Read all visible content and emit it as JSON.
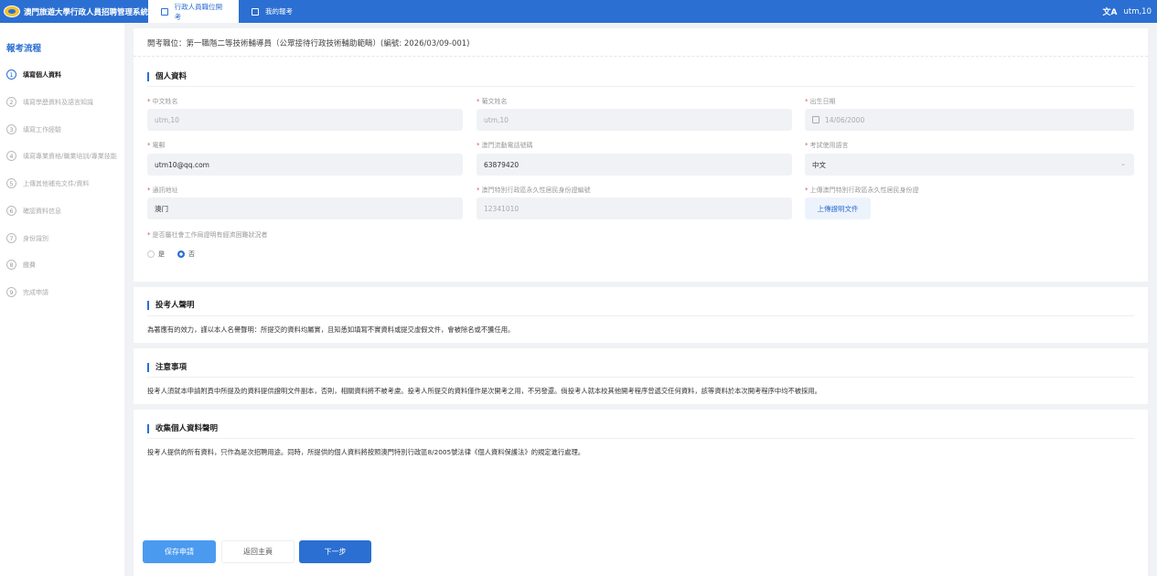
{
  "header": {
    "app_title": "澳門旅遊大學行政人員招聘管理系統",
    "tabs": [
      {
        "label": "行政人員職位開考"
      },
      {
        "label": "我的報考"
      }
    ],
    "user": "utm,10",
    "translate_glyph": "文A"
  },
  "sidebar": {
    "title": "報考流程",
    "steps": [
      {
        "num": "1",
        "label": "填寫個人資料"
      },
      {
        "num": "2",
        "label": "填寫學歷資料及語言知識"
      },
      {
        "num": "3",
        "label": "填寫工作經驗"
      },
      {
        "num": "4",
        "label": "填寫專業資格/職業培訓/專業技能"
      },
      {
        "num": "5",
        "label": "上傳其他補充文件/資料"
      },
      {
        "num": "6",
        "label": "確認資料信息"
      },
      {
        "num": "7",
        "label": "身份識別"
      },
      {
        "num": "8",
        "label": "繳費"
      },
      {
        "num": "9",
        "label": "完成申請"
      }
    ]
  },
  "main": {
    "exam_title": "開考職位：第一職階二等技術輔導員（公眾接待行政技術輔助範疇）(編號: 2026/03/09-001)",
    "personal": {
      "heading": "個人資料",
      "fields": {
        "chinese_name": {
          "label": "中文姓名",
          "value": "utm,10"
        },
        "english_name": {
          "label": "葡文姓名",
          "value": "utm,10"
        },
        "birth_date": {
          "label": "出生日期",
          "value": "14/06/2000"
        },
        "email": {
          "label": "電郵",
          "value": "utm10@qq.com"
        },
        "mobile": {
          "label": "澳門流動電話號碼",
          "value": "63879420"
        },
        "exam_language": {
          "label": "考試使用語言",
          "value": "中文"
        },
        "address": {
          "label": "通訊地址",
          "value": "澳门"
        },
        "id_number": {
          "label": "澳門特別行政區永久性居民身份證編號",
          "value": "12341010"
        },
        "id_upload": {
          "label": "上傳澳門特別行政區永久性居民身份證",
          "button": "上傳證明文件"
        }
      },
      "hardship": {
        "label": "是否屬社會工作局證明有經濟困難狀況者",
        "options": [
          "是",
          "否"
        ],
        "selected": "否"
      }
    },
    "declaration": {
      "heading": "投考人聲明",
      "text": "為著應有的效力，謹以本人名譽聲明：所提交的資料均屬實，且知悉如填寫不實資料或提交虛假文件，會被除名或不獲任用。"
    },
    "notes": {
      "heading": "注意事項",
      "text": "投考人須就本申請附頁中所提及的資料提供證明文件副本，否則，相關資料將不被考慮。投考人所提交的資料僅作是次開考之用，不另發還。倘投考人就本校其他開考程序曾遞交任何資料，該等資料於本次開考程序中均不被採用。"
    },
    "privacy": {
      "heading": "收集個人資料聲明",
      "text": "投考人提供的所有資料，只作為是次招聘用途。同時，所提供的個人資料將按照澳門特別行政區8/2005號法律《個人資料保護法》的規定進行處理。"
    },
    "buttons": {
      "save": "保存申請",
      "home": "返回主頁",
      "next": "下一步"
    }
  },
  "colors": {
    "primary": "#2b6fd2",
    "save": "#4a9af0",
    "required": "#e05555"
  }
}
